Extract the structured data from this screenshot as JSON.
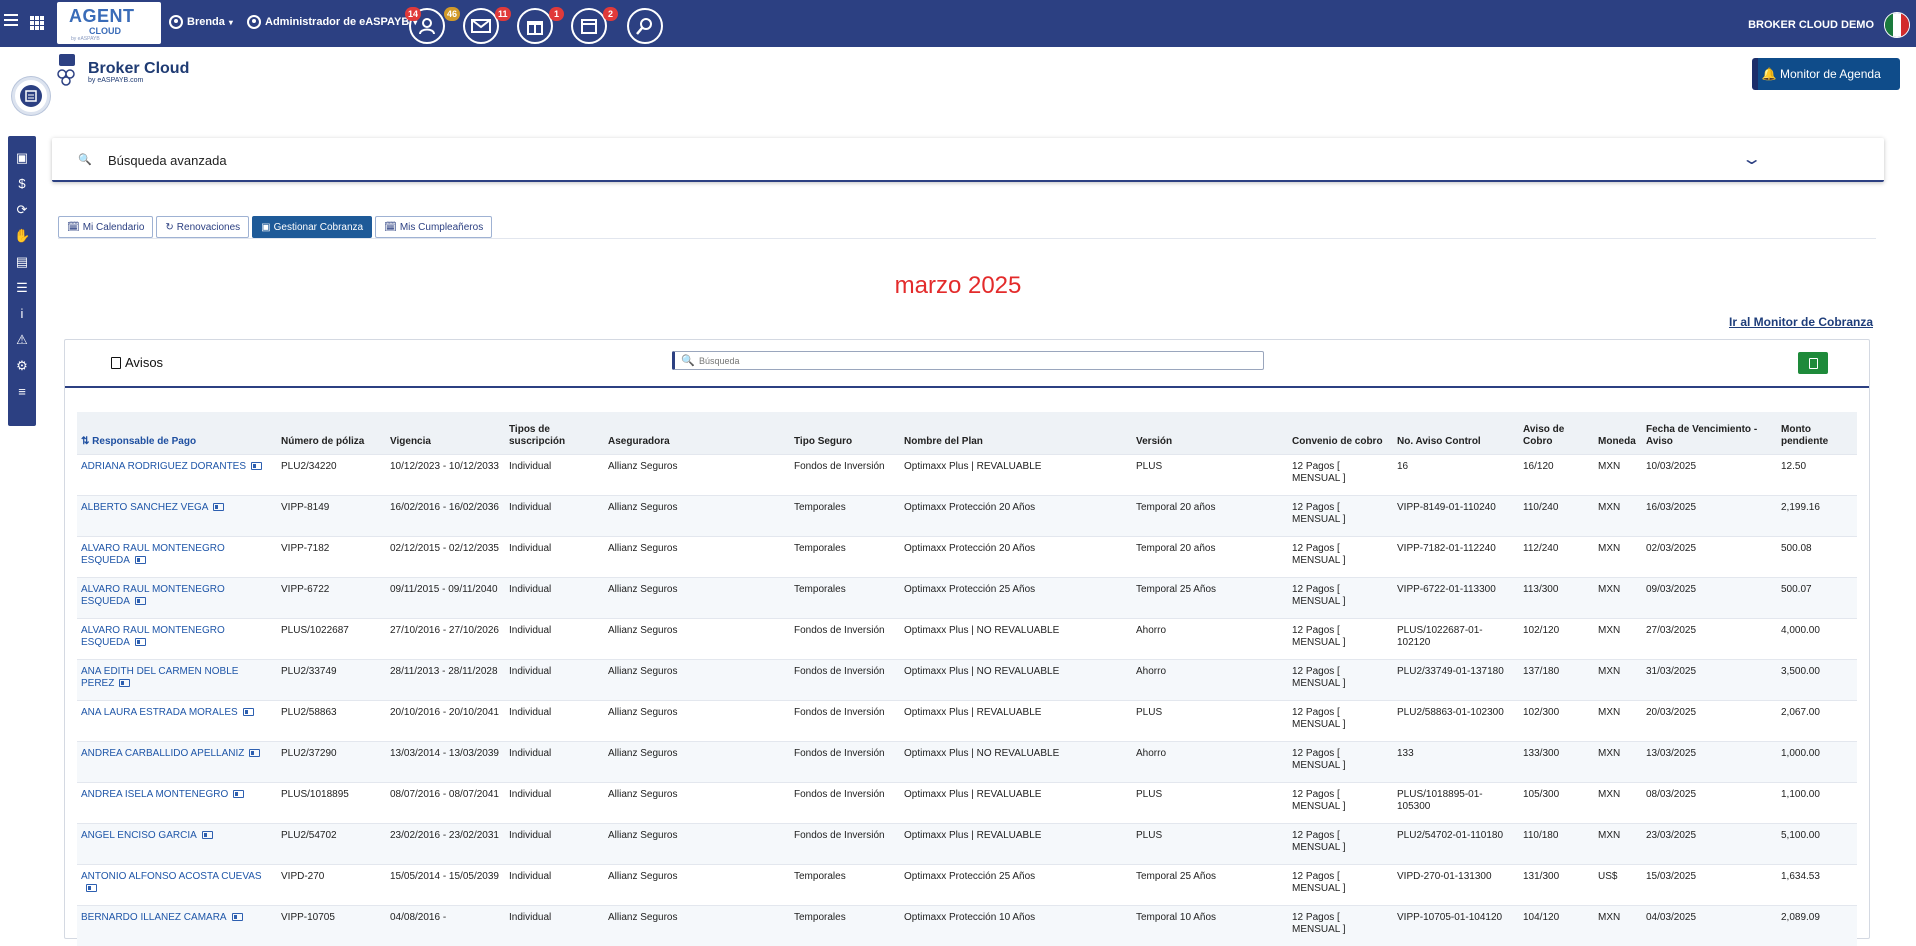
{
  "topbar": {
    "logo_text": "AGENT",
    "logo_sub": "CLOUD",
    "logo_tiny": "by eASPAYB",
    "user_menu": "Brenda",
    "admin_menu": "Administrador de eASPAYB",
    "icons": [
      {
        "name": "contacts-icon",
        "badge": "14",
        "badge2": "46"
      },
      {
        "name": "mail-icon",
        "badge": "11"
      },
      {
        "name": "gift-icon",
        "badge": "1"
      },
      {
        "name": "calendar-icon",
        "badge": "2"
      },
      {
        "name": "user-search-icon",
        "badge": ""
      }
    ],
    "account": "BROKER CLOUD DEMO",
    "accent": "#2c4082"
  },
  "header": {
    "brand_title": "Broker Cloud",
    "brand_sub": "by eASPAYB.com",
    "avatar_text": "📋",
    "monitor_button": "Monitor de Agenda"
  },
  "search": {
    "advanced_label": "Búsqueda avanzada",
    "placeholder": "Búsqueda"
  },
  "tabs": [
    {
      "label": "Mi Calendario",
      "icon": "🗓"
    },
    {
      "label": "Renovaciones",
      "icon": "↻"
    },
    {
      "label": "Gestionar Cobranza",
      "icon": "▣"
    },
    {
      "label": "Mis Cumpleañeros",
      "icon": "🗓"
    }
  ],
  "month_title": "marzo 2025",
  "goto_link": "Ir al Monitor de Cobranza",
  "panel": {
    "title": "Avisos"
  },
  "table": {
    "columns": [
      "Responsable de Pago",
      "Número de póliza",
      "Vigencia",
      "Tipos de suscripción",
      "Aseguradora",
      "Tipo Seguro",
      "Nombre del Plan",
      "Versión",
      "Convenio de cobro",
      "No. Aviso Control",
      "Aviso de Cobro",
      "Moneda",
      "Fecha de Vencimiento - Aviso",
      "Monto pendiente"
    ],
    "rows": [
      [
        "ADRIANA RODRIGUEZ DORANTES",
        "PLU2/34220",
        "10/12/2023 - 10/12/2033",
        "Individual",
        "Allianz Seguros",
        "Fondos de Inversión",
        "Optimaxx Plus | REVALUABLE",
        "PLUS",
        "12 Pagos [ MENSUAL ]",
        "16",
        "16/120",
        "MXN",
        "10/03/2025",
        "12.50"
      ],
      [
        "ALBERTO SANCHEZ VEGA",
        "VIPP-8149",
        "16/02/2016 - 16/02/2036",
        "Individual",
        "Allianz Seguros",
        "Temporales",
        "Optimaxx Protección 20 Años",
        "Temporal 20 años",
        "12 Pagos [ MENSUAL ]",
        "VIPP-8149-01-110240",
        "110/240",
        "MXN",
        "16/03/2025",
        "2,199.16"
      ],
      [
        "ALVARO RAUL MONTENEGRO ESQUEDA",
        "VIPP-7182",
        "02/12/2015 - 02/12/2035",
        "Individual",
        "Allianz Seguros",
        "Temporales",
        "Optimaxx Protección 20 Años",
        "Temporal 20 años",
        "12 Pagos [ MENSUAL ]",
        "VIPP-7182-01-112240",
        "112/240",
        "MXN",
        "02/03/2025",
        "500.08"
      ],
      [
        "ALVARO RAUL MONTENEGRO ESQUEDA",
        "VIPP-6722",
        "09/11/2015 - 09/11/2040",
        "Individual",
        "Allianz Seguros",
        "Temporales",
        "Optimaxx Protección 25 Años",
        "Temporal 25 Años",
        "12 Pagos [ MENSUAL ]",
        "VIPP-6722-01-113300",
        "113/300",
        "MXN",
        "09/03/2025",
        "500.07"
      ],
      [
        "ALVARO RAUL MONTENEGRO ESQUEDA",
        "PLUS/1022687",
        "27/10/2016 - 27/10/2026",
        "Individual",
        "Allianz Seguros",
        "Fondos de Inversión",
        "Optimaxx Plus | NO REVALUABLE",
        "Ahorro",
        "12 Pagos [ MENSUAL ]",
        "PLUS/1022687-01-102120",
        "102/120",
        "MXN",
        "27/03/2025",
        "4,000.00"
      ],
      [
        "ANA EDITH DEL CARMEN NOBLE PEREZ",
        "PLU2/33749",
        "28/11/2013 - 28/11/2028",
        "Individual",
        "Allianz Seguros",
        "Fondos de Inversión",
        "Optimaxx Plus | NO REVALUABLE",
        "Ahorro",
        "12 Pagos [ MENSUAL ]",
        "PLU2/33749-01-137180",
        "137/180",
        "MXN",
        "31/03/2025",
        "3,500.00"
      ],
      [
        "ANA LAURA ESTRADA MORALES",
        "PLU2/58863",
        "20/10/2016 - 20/10/2041",
        "Individual",
        "Allianz Seguros",
        "Fondos de Inversión",
        "Optimaxx Plus | REVALUABLE",
        "PLUS",
        "12 Pagos [ MENSUAL ]",
        "PLU2/58863-01-102300",
        "102/300",
        "MXN",
        "20/03/2025",
        "2,067.00"
      ],
      [
        "ANDREA CARBALLIDO APELLANIZ",
        "PLU2/37290",
        "13/03/2014 - 13/03/2039",
        "Individual",
        "Allianz Seguros",
        "Fondos de Inversión",
        "Optimaxx Plus | NO REVALUABLE",
        "Ahorro",
        "12 Pagos [ MENSUAL ]",
        "133",
        "133/300",
        "MXN",
        "13/03/2025",
        "1,000.00"
      ],
      [
        "ANDREA ISELA MONTENEGRO",
        "PLUS/1018895",
        "08/07/2016 - 08/07/2041",
        "Individual",
        "Allianz Seguros",
        "Fondos de Inversión",
        "Optimaxx Plus | REVALUABLE",
        "PLUS",
        "12 Pagos [ MENSUAL ]",
        "PLUS/1018895-01-105300",
        "105/300",
        "MXN",
        "08/03/2025",
        "1,100.00"
      ],
      [
        "ANGEL ENCISO GARCIA",
        "PLU2/54702",
        "23/02/2016 - 23/02/2031",
        "Individual",
        "Allianz Seguros",
        "Fondos de Inversión",
        "Optimaxx Plus | REVALUABLE",
        "PLUS",
        "12 Pagos [ MENSUAL ]",
        "PLU2/54702-01-110180",
        "110/180",
        "MXN",
        "23/03/2025",
        "5,100.00"
      ],
      [
        "ANTONIO ALFONSO ACOSTA CUEVAS",
        "VIPD-270",
        "15/05/2014 - 15/05/2039",
        "Individual",
        "Allianz Seguros",
        "Temporales",
        "Optimaxx Protección 25 Años",
        "Temporal 25 Años",
        "12 Pagos [ MENSUAL ]",
        "VIPD-270-01-131300",
        "131/300",
        "US$",
        "15/03/2025",
        "1,634.53"
      ],
      [
        "BERNARDO ILLANEZ CAMARA",
        "VIPP-10705",
        "04/08/2016 -",
        "Individual",
        "Allianz Seguros",
        "Temporales",
        "Optimaxx Protección 10 Años",
        "Temporal 10 Años",
        "12 Pagos [ MENSUAL ]",
        "VIPP-10705-01-104120",
        "104/120",
        "MXN",
        "04/03/2025",
        "2,089.09"
      ]
    ]
  }
}
